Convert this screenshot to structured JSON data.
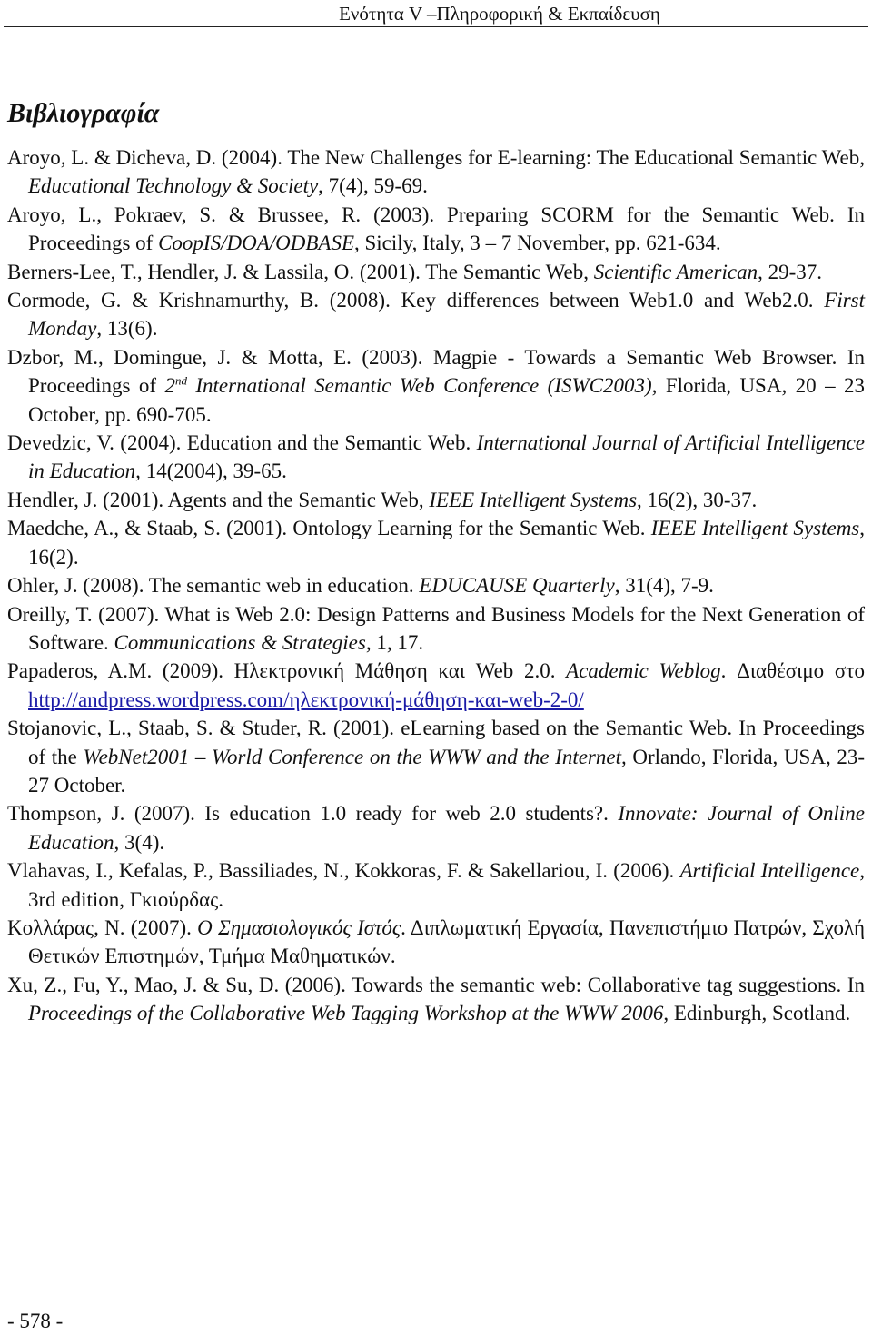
{
  "header": {
    "running_title": "Ενότητα V –Πληροφορική & Εκπαίδευση"
  },
  "section": {
    "title": "Βιβλιογραφία"
  },
  "references": [
    {
      "part1": "Aroyo, L. & Dicheva, D. (2004). The New Challenges for E-learning: The Educational Semantic Web, ",
      "italic1": "Educational Technology & Society",
      "part2": ", 7(4), 59-69."
    },
    {
      "part1": "Aroyo, L., Pokraev, S. & Brussee, R. (2003). Preparing SCORM for the Semantic Web. In Proceedings of ",
      "italic1": "CoopIS/DOA/ODBASE",
      "part2": ", Sicily, Italy, 3 – 7 November, pp. 621-634."
    },
    {
      "part1": "Berners-Lee, T., Hendler, J. & Lassila, O. (2001). The Semantic Web, ",
      "italic1": "Scientific American",
      "part2": ", 29-37."
    },
    {
      "part1": "Cormode, G. & Krishnamurthy, B. (2008). Key differences between Web1.0 and Web2.0. ",
      "italic1": "First Monday",
      "part2": ", 13(6)."
    },
    {
      "part1": "Dzbor, M., Domingue, J. & Motta, E. (2003). Magpie - Towards a Semantic Web Browser. In Proceedings of ",
      "italic_pre": "2",
      "sup": "nd",
      "italic1": " International Semantic Web Conference (ISWC2003)",
      "part2": ", Florida, USA, 20 – 23 October, pp. 690-705."
    },
    {
      "part1": "Devedzic, V. (2004). Education and the Semantic Web. ",
      "italic1": "International Journal of Artificial Intelligence in Education,",
      "part2": " 14(2004), 39-65."
    },
    {
      "part1": "Hendler, J. (2001). Agents and the Semantic Web, ",
      "italic1": "IEEE Intelligent Systems",
      "part2": ", 16(2), 30-37."
    },
    {
      "part1": "Maedche, A., & Staab, S. (2001). Ontology Learning for the Semantic Web. ",
      "italic1": "IEEE Intelligent Systems",
      "part2": ", 16(2)."
    },
    {
      "part1": "Ohler, J. (2008). The semantic web in education. ",
      "italic1": "EDUCAUSE Quarterly",
      "part2": ", 31(4), 7-9."
    },
    {
      "part1": "Oreilly, T. (2007). What is Web 2.0: Design Patterns and Business Models for the Next Generation of Software. ",
      "italic1": "Communications & Strategies",
      "part2": ", 1, 17."
    },
    {
      "part1": "Papaderos, A.M. (2009). Ηλεκτρονική Μάθηση και Web 2.0. ",
      "italic1": "Academic Weblog",
      "part2": ". Διαθέσιμο στο ",
      "link": "http://andpress.wordpress.com/ηλεκτρονική-μάθηση-και-web-2-0/"
    },
    {
      "part1": "Stojanovic, L., Staab, S. & Studer, R. (2001). eLearning based on the Semantic Web. In Proceedings of the ",
      "italic1": "WebNet2001 – World Conference on the WWW and the Internet,",
      "part2": " Orlando, Florida, USA, 23-27 October."
    },
    {
      "part1": "Thompson, J. (2007). Is education 1.0 ready for web 2.0 students?. ",
      "italic1": "Innovate: Journal of Online Education",
      "part2": ", 3(4)."
    },
    {
      "part1": "Vlahavas, I., Kefalas, P., Bassiliades, N., Kokkoras, F. & Sakellariou, I. (2006). ",
      "italic1": "Artificial Intelligence",
      "part2": ", 3rd edition,  Γκιούρδας."
    },
    {
      "part1": "Κολλάρας, Ν. (2007). ",
      "italic1": "Ο Σημασιολογικός Ιστός",
      "part2": ". Διπλωματική Εργασία, Πανεπιστήμιο Πατρών, Σχολή Θετικών Επιστημών, Τμήμα Μαθηματικών."
    },
    {
      "part1": "Xu, Z., Fu, Y., Mao, J. & Su, D. (2006). Towards the semantic web: Collaborative tag suggestions. In ",
      "italic1": "Proceedings of the Collaborative Web Tagging Workshop at the WWW 2006",
      "part2": ", Edinburgh, Scotland."
    }
  ],
  "footer": {
    "page_number": "- 578 -"
  }
}
